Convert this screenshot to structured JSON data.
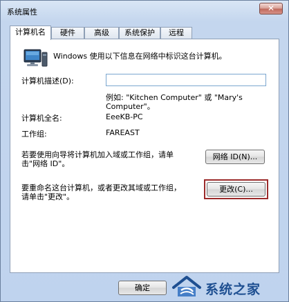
{
  "window": {
    "title": "系统属性",
    "close_glyph": "✕"
  },
  "tabs": [
    {
      "label": "计算机名",
      "active": true
    },
    {
      "label": "硬件",
      "active": false
    },
    {
      "label": "高级",
      "active": false
    },
    {
      "label": "系统保护",
      "active": false
    },
    {
      "label": "远程",
      "active": false
    }
  ],
  "panel": {
    "intro_text": "Windows 使用以下信息在网络中标识这台计算机。",
    "description_label": "计算机描述(D):",
    "description_value": "",
    "example_line1": "例如: \"Kitchen Computer\" 或 \"Mary's",
    "example_line2": "Computer\"。",
    "full_name_label": "计算机全名:",
    "full_name_value": "EeeKB-PC",
    "workgroup_label": "工作组:",
    "workgroup_value": "FAREAST",
    "wizard_text_line1": "若要使用向导将计算机加入域或工作组，请单",
    "wizard_text_line2": "击\"网络 ID\"。",
    "network_id_button": "网络 ID(N)...",
    "rename_text_line1": "要重命名这台计算机，或者更改其域或工作组，",
    "rename_text_line2": "请单击\"更改\"。",
    "change_button": "更改(C)..."
  },
  "footer": {
    "ok_button": "确定"
  },
  "watermark": {
    "text": "系统之家"
  },
  "colors": {
    "highlight_border": "#9b2a2a",
    "watermark_blue": "#1e4f91"
  }
}
